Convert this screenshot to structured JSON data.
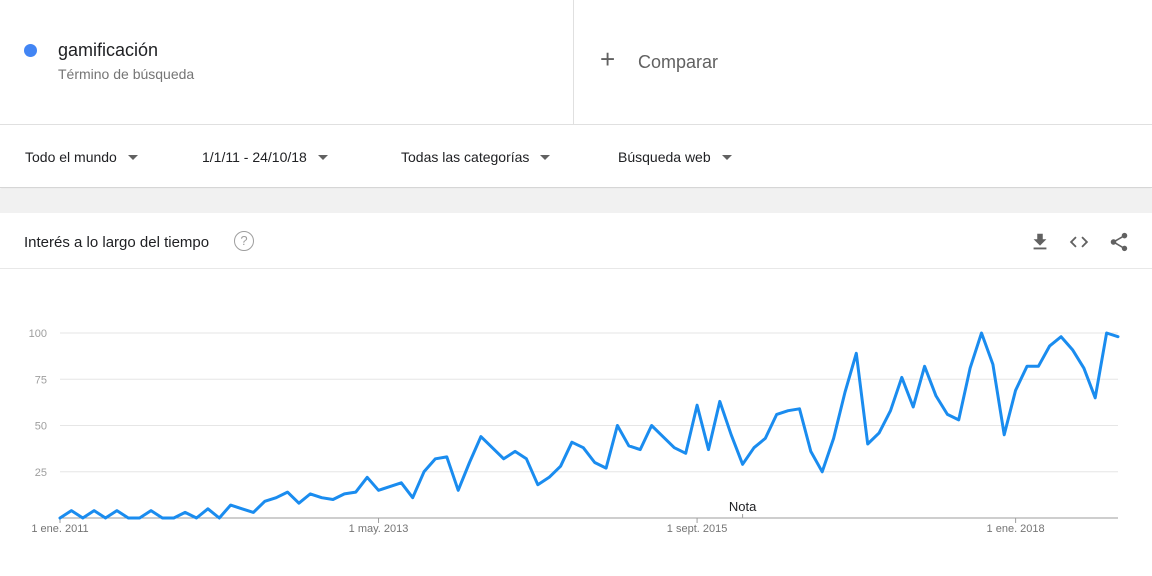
{
  "search_term": {
    "name": "gamificación",
    "subtitle": "Término de búsqueda",
    "color": "#4285f4"
  },
  "compare": {
    "plus": "+",
    "label": "Comparar"
  },
  "filters": [
    {
      "label": "Todo el mundo"
    },
    {
      "label": "1/1/11 - 24/10/18"
    },
    {
      "label": "Todas las categorías"
    },
    {
      "label": "Búsqueda web"
    }
  ],
  "card": {
    "title": "Interés a lo largo del tiempo",
    "help": "?",
    "icons": [
      "download-icon",
      "embed-code-icon",
      "share-icon"
    ]
  },
  "chart_data": {
    "type": "line",
    "title": "",
    "xlabel": "",
    "ylabel": "",
    "ylim": [
      0,
      100
    ],
    "y_ticks": [
      25,
      50,
      75,
      100
    ],
    "x_ticks": [
      {
        "label": "1 ene. 2011",
        "index": 0
      },
      {
        "label": "1 may. 2013",
        "index": 28
      },
      {
        "label": "1 sept. 2015",
        "index": 56
      },
      {
        "label": "1 ene. 2018",
        "index": 84
      }
    ],
    "grid": true,
    "line_color": "#1a8cef",
    "annotation": {
      "label": "Nota",
      "index": 60
    },
    "series": [
      {
        "values": [
          0,
          4,
          0,
          4,
          0,
          4,
          0,
          0,
          4,
          0,
          0,
          3,
          0,
          5,
          0,
          7,
          5,
          3,
          9,
          11,
          14,
          8,
          13,
          11,
          10,
          13,
          14,
          22,
          15,
          17,
          19,
          11,
          25,
          32,
          33,
          15,
          30,
          44,
          38,
          32,
          36,
          32,
          18,
          22,
          28,
          41,
          38,
          30,
          27,
          50,
          39,
          37,
          50,
          44,
          38,
          35,
          61,
          37,
          63,
          45,
          29,
          38,
          43,
          56,
          58,
          59,
          36,
          25,
          43,
          68,
          89,
          40,
          46,
          58,
          76,
          60,
          82,
          66,
          56,
          53,
          81,
          100,
          83,
          45,
          69,
          82,
          82,
          93,
          98,
          91,
          81,
          65,
          100,
          98
        ]
      }
    ]
  }
}
